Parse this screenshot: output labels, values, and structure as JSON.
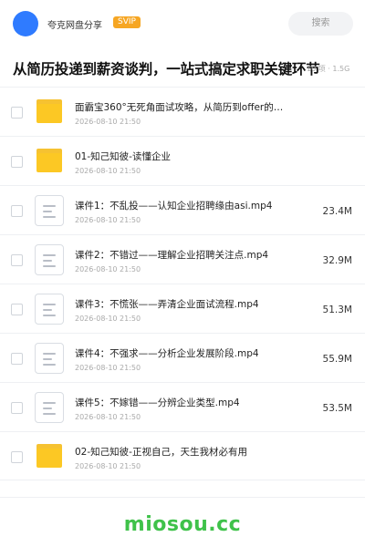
{
  "header": {
    "owner_name": "夸克网盘分享",
    "badge": "SVIP",
    "search_label": "搜索"
  },
  "title_bar": {
    "title": "从简历投递到薪资谈判，一站式搞定求职关键环节",
    "meta": "10 项 · 1.5G"
  },
  "files": [
    {
      "type": "folder",
      "name": "面霸宝360°无死角面试攻略，从简历到offer的…",
      "date": "2026-08-10 21:50",
      "size": ""
    },
    {
      "type": "folder",
      "name": "01-知己知彼-读懂企业",
      "date": "2026-08-10 21:50",
      "size": ""
    },
    {
      "type": "file",
      "name": "课件1：不乱投——认知企业招聘缘由asi.mp4",
      "date": "2026-08-10 21:50",
      "size": "23.4M"
    },
    {
      "type": "file",
      "name": "课件2：不错过——理解企业招聘关注点.mp4",
      "date": "2026-08-10 21:50",
      "size": "32.9M"
    },
    {
      "type": "file",
      "name": "课件3：不慌张——弄清企业面试流程.mp4",
      "date": "2026-08-10 21:50",
      "size": "51.3M"
    },
    {
      "type": "file",
      "name": "课件4：不强求——分析企业发展阶段.mp4",
      "date": "2026-08-10 21:50",
      "size": "55.9M"
    },
    {
      "type": "file",
      "name": "课件5：不嫁错——分辨企业类型.mp4",
      "date": "2026-08-10 21:50",
      "size": "53.5M"
    },
    {
      "type": "folder",
      "name": "02-知己知彼-正视自己，天生我材必有用",
      "date": "2026-08-10 21:50",
      "size": ""
    }
  ],
  "watermark": "miosou.cc"
}
